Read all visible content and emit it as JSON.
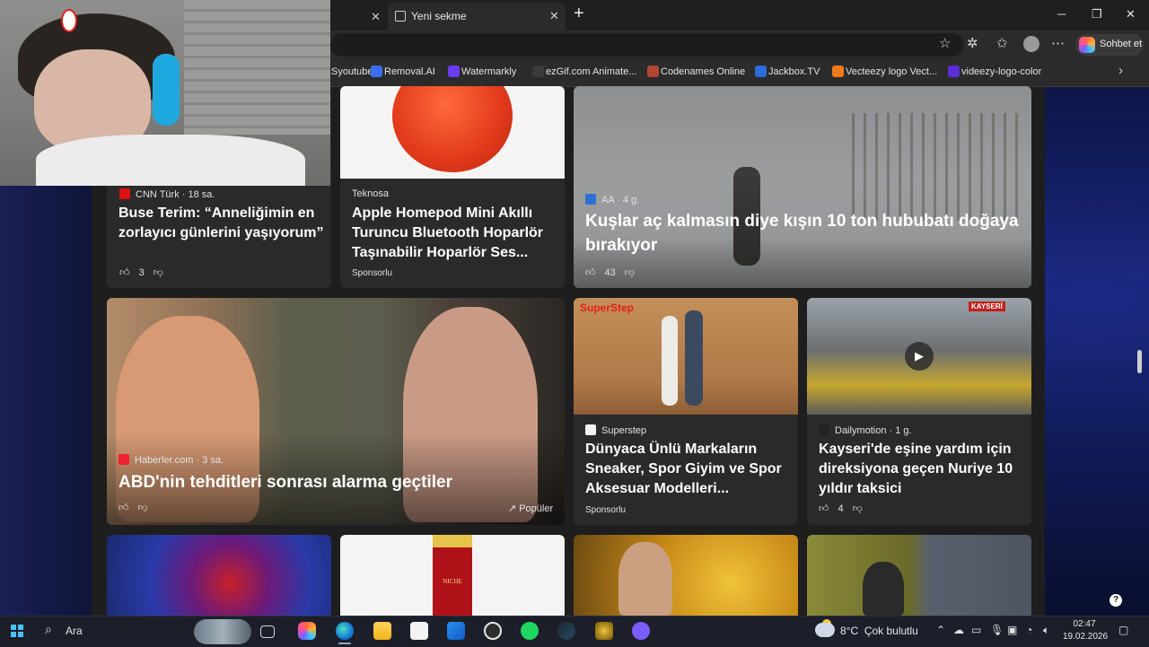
{
  "browser": {
    "tabs": [
      {
        "label": ""
      },
      {
        "label": "Yeni sekme"
      }
    ],
    "copilot_label": "Sohbet et",
    "bookmarks": [
      {
        "label": "Syoutube",
        "color": "#2b2b2b"
      },
      {
        "label": "Removal.AI",
        "color": "#3b6df0"
      },
      {
        "label": "Watermarkly",
        "color": "#6a3df0"
      },
      {
        "label": "ezGif.com Animate...",
        "color": "#3a3a3a"
      },
      {
        "label": "Codenames Online",
        "color": "#b2462e"
      },
      {
        "label": "Jackbox.TV",
        "color": "#2f6bd8"
      },
      {
        "label": "Vecteezy logo Vect...",
        "color": "#f07a1a"
      },
      {
        "label": "videezy-logo-color",
        "color": "#5b2dd8"
      }
    ]
  },
  "feed": {
    "cards": [
      {
        "source": "CNN Türk",
        "age": "· 18 sa.",
        "title": "Buse Terim: “Anneliğimin en zorlayıcı günlerini yaşıyorum”",
        "likes": "3"
      },
      {
        "source": "Teknosa",
        "title": "Apple Homepod Mini Akıllı Turuncu Bluetooth Hoparlör Taşınabilir Hoparlör Ses...",
        "sponsored": "Sponsorlu"
      },
      {
        "source": "AA",
        "age": "· 4 g.",
        "title": "Kuşlar aç kalmasın diye kışın 10 ton hububatı doğaya bırakıyor",
        "likes": "43"
      },
      {
        "source": "Haberler.com",
        "age": "· 3 sa.",
        "title": "ABD'nin tehditleri sonrası alarma geçtiler",
        "badge": "Popüler"
      },
      {
        "source": "Superstep",
        "brand": "SuperStep",
        "title": "Dünyaca Ünlü Markaların Sneaker, Spor Giyim ve Spor Aksesuar Modelleri...",
        "sponsored": "Sponsorlu"
      },
      {
        "source": "Dailymotion",
        "age": "· 1 g.",
        "title": "Kayseri'de eşine yardım için direksiyona geçen Nuriye 10 yıldır taksici",
        "likes": "4",
        "image_text": "KAYSERİ"
      },
      {
        "product_text": "NICHE"
      }
    ]
  },
  "taskbar": {
    "search_label": "Ara",
    "weather": {
      "temp": "8°C",
      "condition": "Çok bulutlu"
    },
    "clock": {
      "time": "02:47",
      "date": "19.02.2026"
    }
  },
  "colors": {
    "accent": "#4cc2ff",
    "card_bg": "#2a2a2a",
    "feed_bg": "#1e1e1e"
  }
}
